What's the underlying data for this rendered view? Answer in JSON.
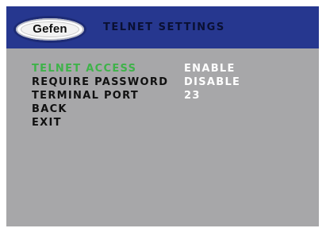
{
  "header": {
    "logo_text": "Gefen",
    "title": "TELNET SETTINGS"
  },
  "menu": {
    "items": [
      {
        "label": "TELNET ACCESS",
        "value": "ENABLE",
        "selected": true
      },
      {
        "label": "REQUIRE PASSWORD",
        "value": "DISABLE",
        "selected": false
      },
      {
        "label": "TERMINAL PORT",
        "value": "23",
        "selected": false
      },
      {
        "label": "BACK",
        "value": "",
        "selected": false
      },
      {
        "label": "EXIT",
        "value": "",
        "selected": false
      }
    ]
  },
  "colors": {
    "header_bg": "#26378f",
    "panel_bg": "#a7a7a9",
    "selected_text": "#3fb24a",
    "value_text": "#ffffff",
    "label_text": "#111111"
  }
}
